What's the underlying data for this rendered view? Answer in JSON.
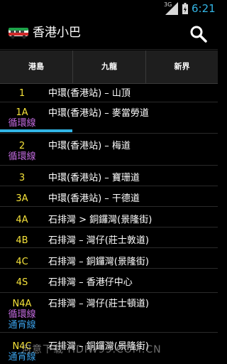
{
  "status_bar": {
    "network": "3G",
    "time": "6:21",
    "icons": [
      "signal-icon",
      "battery-icon"
    ]
  },
  "action_bar": {
    "title": "香港小巴",
    "icons": [
      "minibus-app-icon",
      "search-icon"
    ]
  },
  "tabs": [
    {
      "label": "港島",
      "selected": true
    },
    {
      "label": "九龍",
      "selected": false
    },
    {
      "label": "新界",
      "selected": false
    }
  ],
  "colors": {
    "accent": "#33b5e5",
    "route_number": "#f5e23a",
    "circular_tag": "#c36be0",
    "overnight_tag": "#3aa0e8"
  },
  "routes": [
    {
      "number": "1",
      "tags": [],
      "description": "中環(香港站) – 山頂"
    },
    {
      "number": "1A",
      "tags": [
        "循環線"
      ],
      "description": "中環(香港站) – 麥當勞道"
    },
    {
      "number": "2",
      "tags": [
        "循環線"
      ],
      "description": "中環(香港站) – 梅道"
    },
    {
      "number": "3",
      "tags": [],
      "description": "中環(香港站) – 寶珊道"
    },
    {
      "number": "3A",
      "tags": [],
      "description": "中環(香港站) – 干德道"
    },
    {
      "number": "4A",
      "tags": [],
      "description": "石排灣 > 銅鑼灣(景隆街)"
    },
    {
      "number": "4B",
      "tags": [],
      "description": "石排灣 – 灣仔(莊士敦道)"
    },
    {
      "number": "4C",
      "tags": [],
      "description": "石排灣 – 銅鑼灣(景隆街)"
    },
    {
      "number": "4S",
      "tags": [],
      "description": "石排灣 – 香港仔中心"
    },
    {
      "number": "N4A",
      "tags": [
        "循環線",
        "通宵線"
      ],
      "description": "石排灣 – 灣仔(莊士頓道)"
    },
    {
      "number": "N4C",
      "tags": [
        "通宵線"
      ],
      "description": "石排灣 – 銅鑼灣(景隆街)"
    }
  ],
  "watermark": "河意下载·HDIW99.COM.CN"
}
